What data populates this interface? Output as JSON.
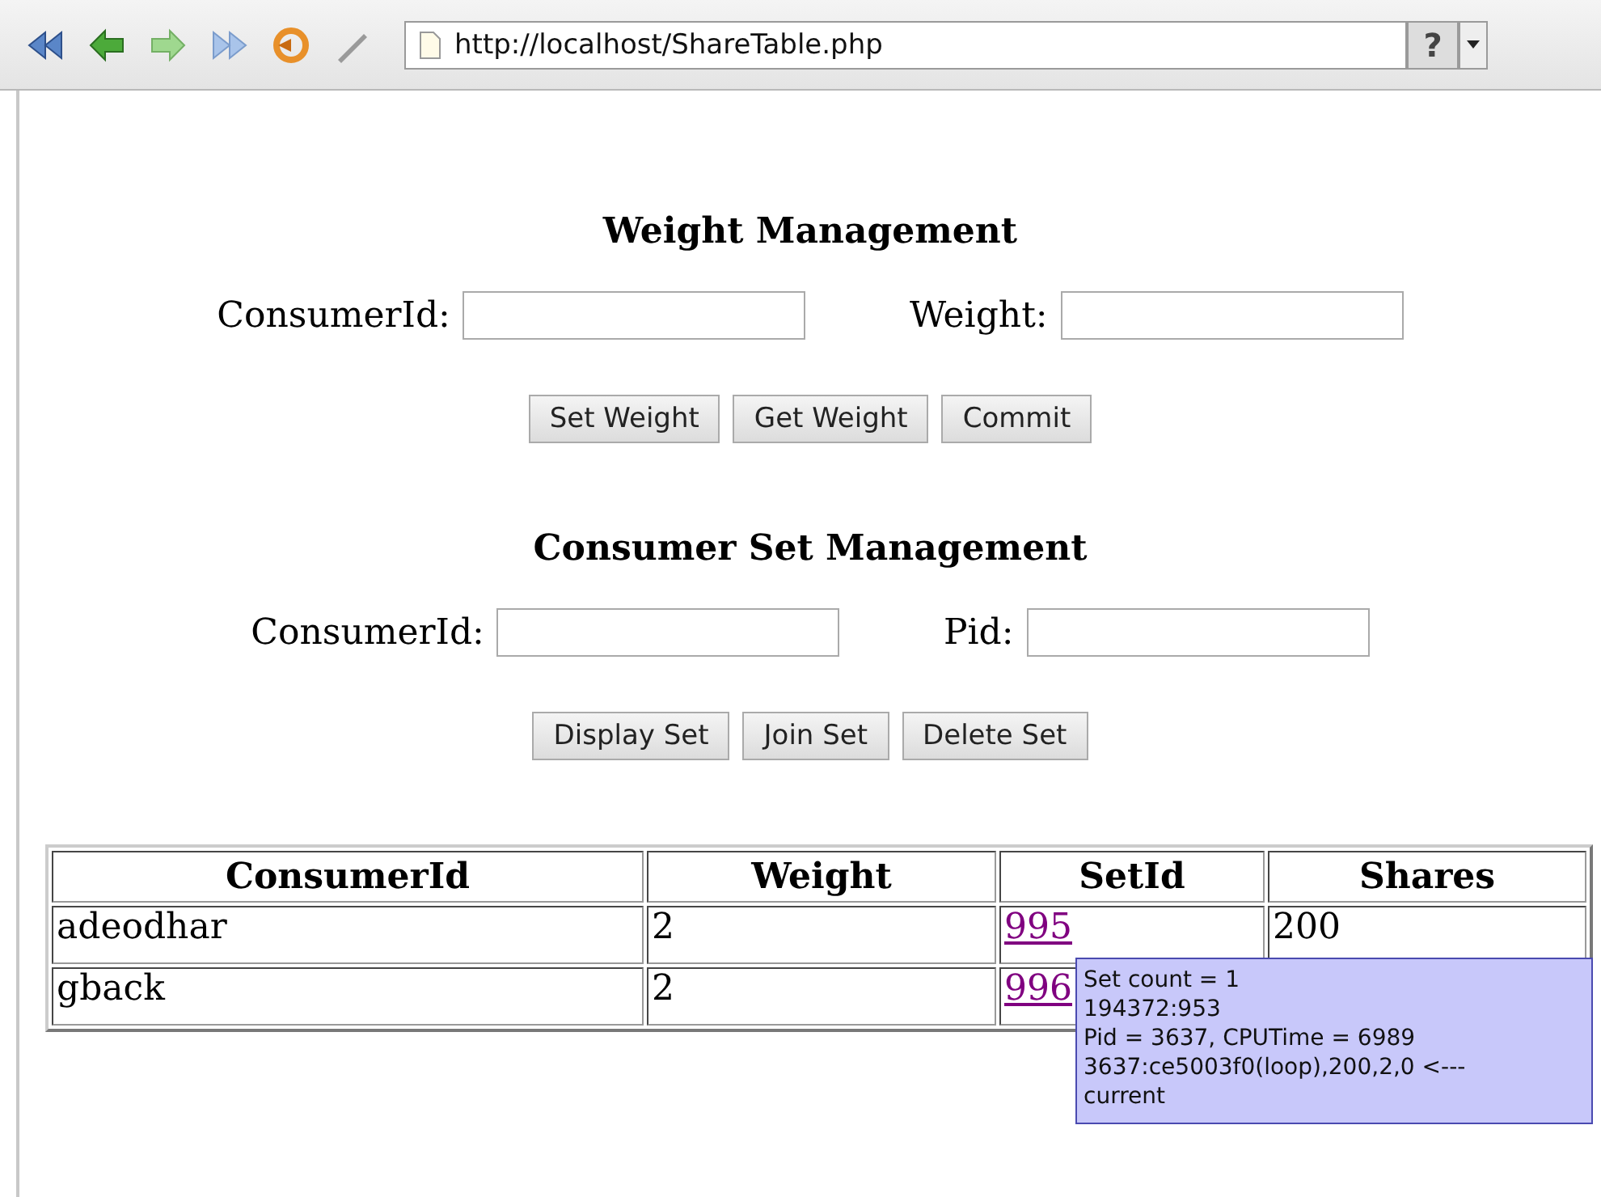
{
  "toolbar": {
    "url": "http://localhost/ShareTable.php",
    "help": "?"
  },
  "sections": [
    {
      "title": "Weight Management",
      "fields": [
        {
          "label": "ConsumerId:"
        },
        {
          "label": "Weight:"
        }
      ],
      "buttons": [
        "Set Weight",
        "Get Weight",
        "Commit"
      ]
    },
    {
      "title": "Consumer Set Management",
      "fields": [
        {
          "label": "ConsumerId:"
        },
        {
          "label": "Pid:"
        }
      ],
      "buttons": [
        "Display Set",
        "Join Set",
        "Delete Set"
      ]
    }
  ],
  "table": {
    "columns": [
      "ConsumerId",
      "Weight",
      "SetId",
      "Shares"
    ],
    "rows": [
      {
        "cells": [
          "adeodhar",
          "2",
          "995",
          "200"
        ]
      },
      {
        "cells": [
          "gback",
          "2",
          "996",
          ""
        ]
      }
    ]
  },
  "tooltip": {
    "lines": [
      "Set count = 1",
      "194372:953",
      "Pid = 3637, CPUTime = 6989",
      "3637:ce5003f0(loop),200,2,0 <---",
      "current"
    ]
  }
}
